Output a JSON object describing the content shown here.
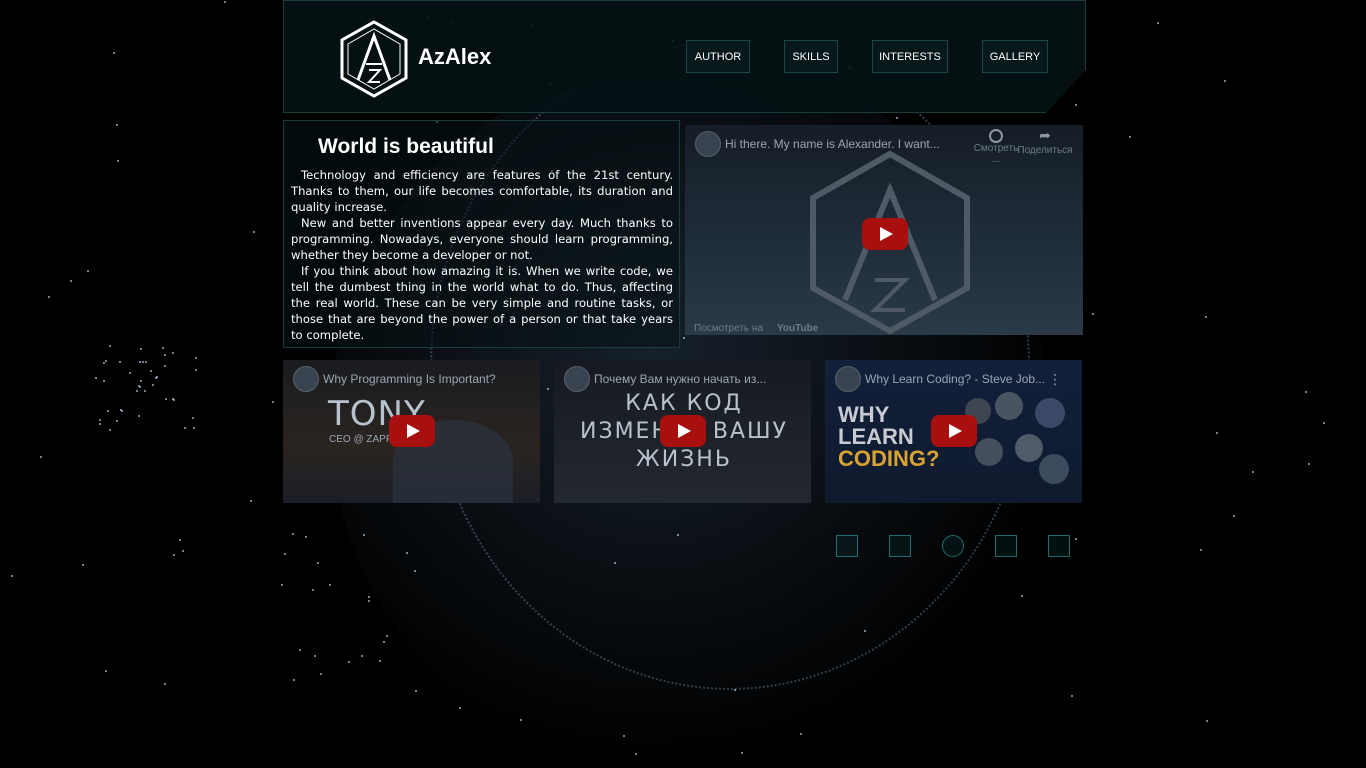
{
  "brand": {
    "name": "AzAlex",
    "logo_letters": "Az"
  },
  "nav": [
    {
      "label": "AUTHOR"
    },
    {
      "label": "SKILLS"
    },
    {
      "label": "INTERESTS"
    },
    {
      "label": "GALLERY"
    }
  ],
  "article": {
    "title": "World is beautiful",
    "paragraphs": [
      "Technology and efficiency are features of the 21st century. Thanks to them, our life becomes comfortable, its duration and quality increase.",
      "New and better inventions appear every day. Much thanks to programming. Nowadays, everyone should learn programming, whether they become a developer or not.",
      "If you think about how amazing it is. When we write code, we tell the dumbest thing in the world what to do. Thus, affecting the real world. These can be very simple and routine tasks, or those that are beyond the power of a person or that take years to complete."
    ]
  },
  "main_video": {
    "title": "Hi there. My name is Alexander. I want...",
    "watch_later": "Смотреть ...",
    "share": "Поделиться",
    "watch_on": "Посмотреть на",
    "youtube": "YouTube"
  },
  "videos": [
    {
      "title": "Why Programming Is Important?",
      "overlay": "TONY",
      "caption": "CEO @ ZAPPOS"
    },
    {
      "title": "Почему Вам нужно начать из...",
      "overlay": "КАК КОД ИЗМЕНИТ ВАШУ ЖИЗНЬ"
    },
    {
      "title": "Why Learn Coding? - Steve Job...",
      "overlay_line1": "WHY",
      "overlay_line2": "LEARN",
      "overlay_line3": "CODING?"
    }
  ],
  "social": [
    "social-icon-1",
    "social-icon-2",
    "social-icon-3",
    "social-icon-4",
    "social-icon-5"
  ],
  "colors": {
    "accent": "#1e6b6b",
    "play": "#a80f0f",
    "coding": "#d9a233"
  }
}
